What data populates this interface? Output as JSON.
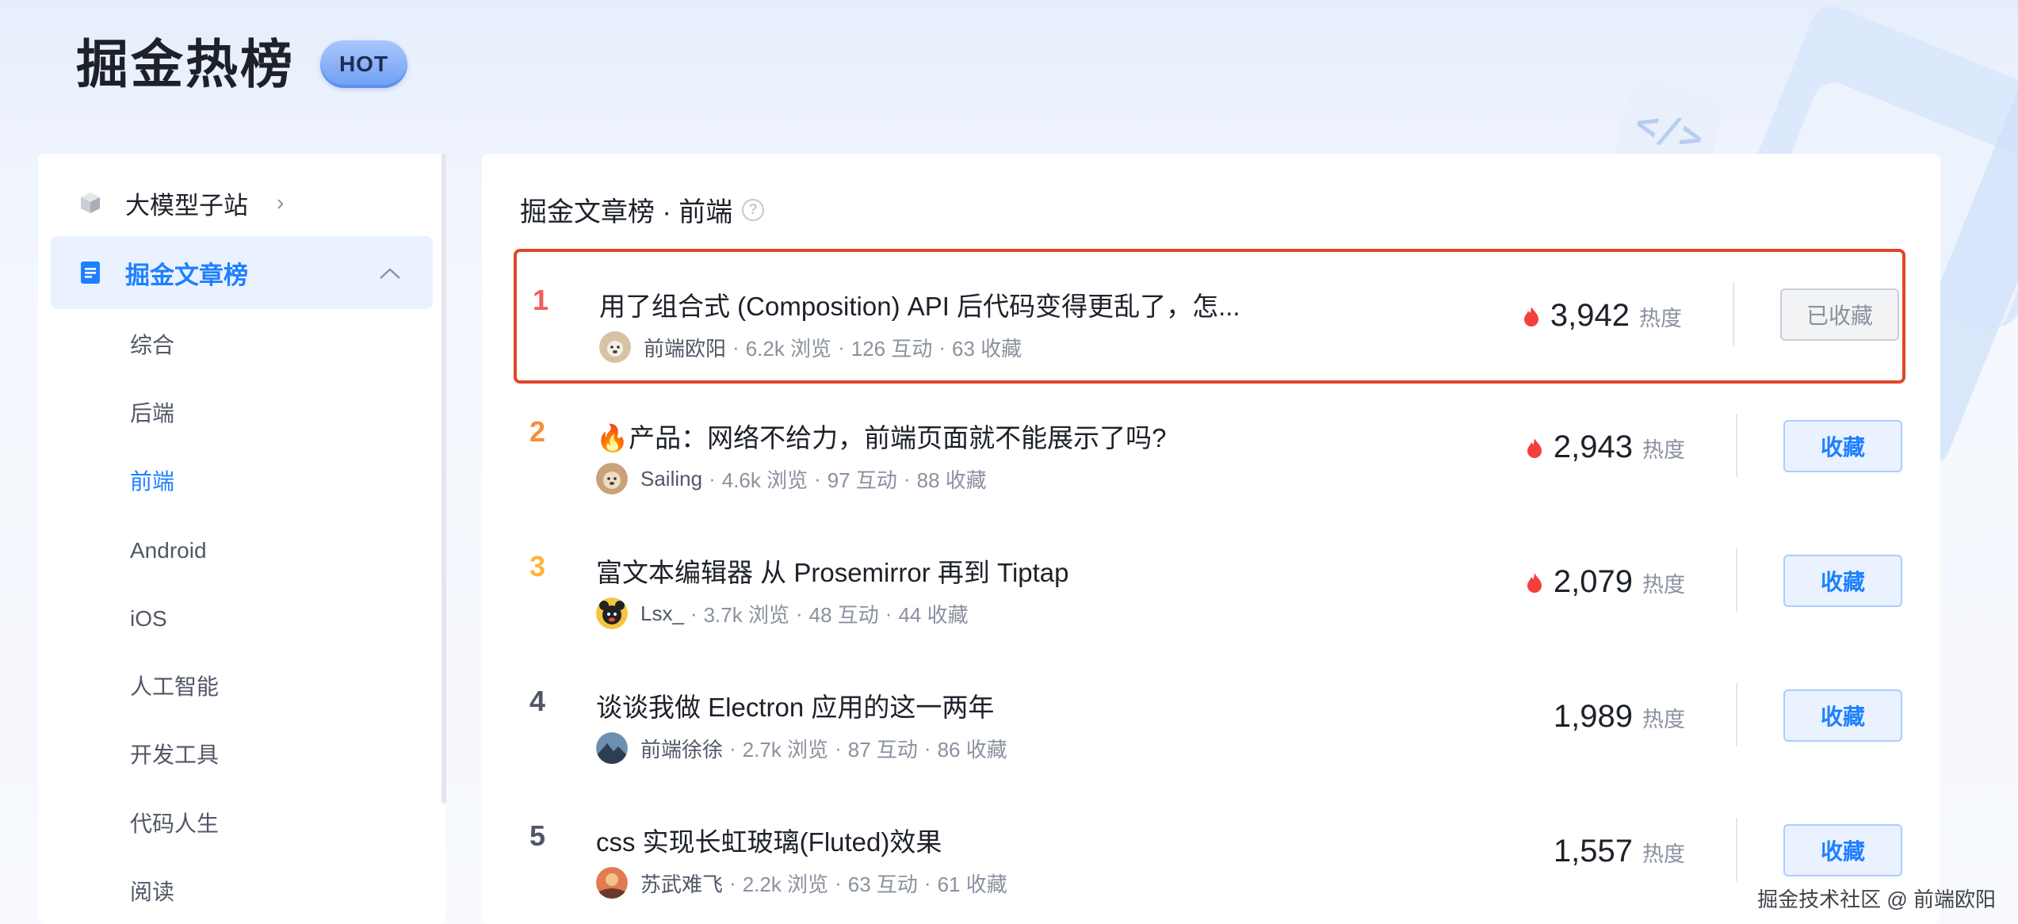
{
  "header": {
    "title": "掘金热榜",
    "badge": "HOT"
  },
  "sidebar": {
    "top_items": [
      {
        "label": "大模型子站",
        "icon": "cube-icon",
        "expanded": false
      },
      {
        "label": "掘金文章榜",
        "icon": "document-icon",
        "expanded": true
      }
    ],
    "sub_items": [
      "综合",
      "后端",
      "前端",
      "Android",
      "iOS",
      "人工智能",
      "开发工具",
      "代码人生",
      "阅读"
    ],
    "active_sub": "前端"
  },
  "main": {
    "title": "掘金文章榜 · 前端",
    "heat_label": "热度",
    "articles": [
      {
        "rank": "1",
        "title": "用了组合式 (Composition) API 后代码变得更乱了，怎...",
        "author": "前端欧阳",
        "views": "6.2k 浏览",
        "interactions": "126 互动",
        "collections": "63 收藏",
        "heat": "3,942",
        "hot": true,
        "button": "已收藏",
        "collected": true
      },
      {
        "rank": "2",
        "title": "🔥产品：网络不给力，前端页面就不能展示了吗?",
        "author": "Sailing",
        "views": "4.6k 浏览",
        "interactions": "97 互动",
        "collections": "88 收藏",
        "heat": "2,943",
        "hot": true,
        "button": "收藏",
        "collected": false
      },
      {
        "rank": "3",
        "title": "富文本编辑器 从 Prosemirror 再到 Tiptap",
        "author": "Lsx_",
        "views": "3.7k 浏览",
        "interactions": "48 互动",
        "collections": "44 收藏",
        "heat": "2,079",
        "hot": true,
        "button": "收藏",
        "collected": false
      },
      {
        "rank": "4",
        "title": "谈谈我做 Electron 应用的这一两年",
        "author": "前端徐徐",
        "views": "2.7k 浏览",
        "interactions": "87 互动",
        "collections": "86 收藏",
        "heat": "1,989",
        "hot": false,
        "button": "收藏",
        "collected": false
      },
      {
        "rank": "5",
        "title": "css 实现长虹玻璃(Fluted)效果",
        "author": "苏武难飞",
        "views": "2.2k 浏览",
        "interactions": "63 互动",
        "collections": "61 收藏",
        "heat": "1,557",
        "hot": false,
        "button": "收藏",
        "collected": false
      }
    ]
  },
  "watermark": "掘金技术社区 @ 前端欧阳",
  "colors": {
    "accent": "#1e80ff",
    "highlight_border": "#e0462b",
    "fire": "#f53f3f"
  }
}
